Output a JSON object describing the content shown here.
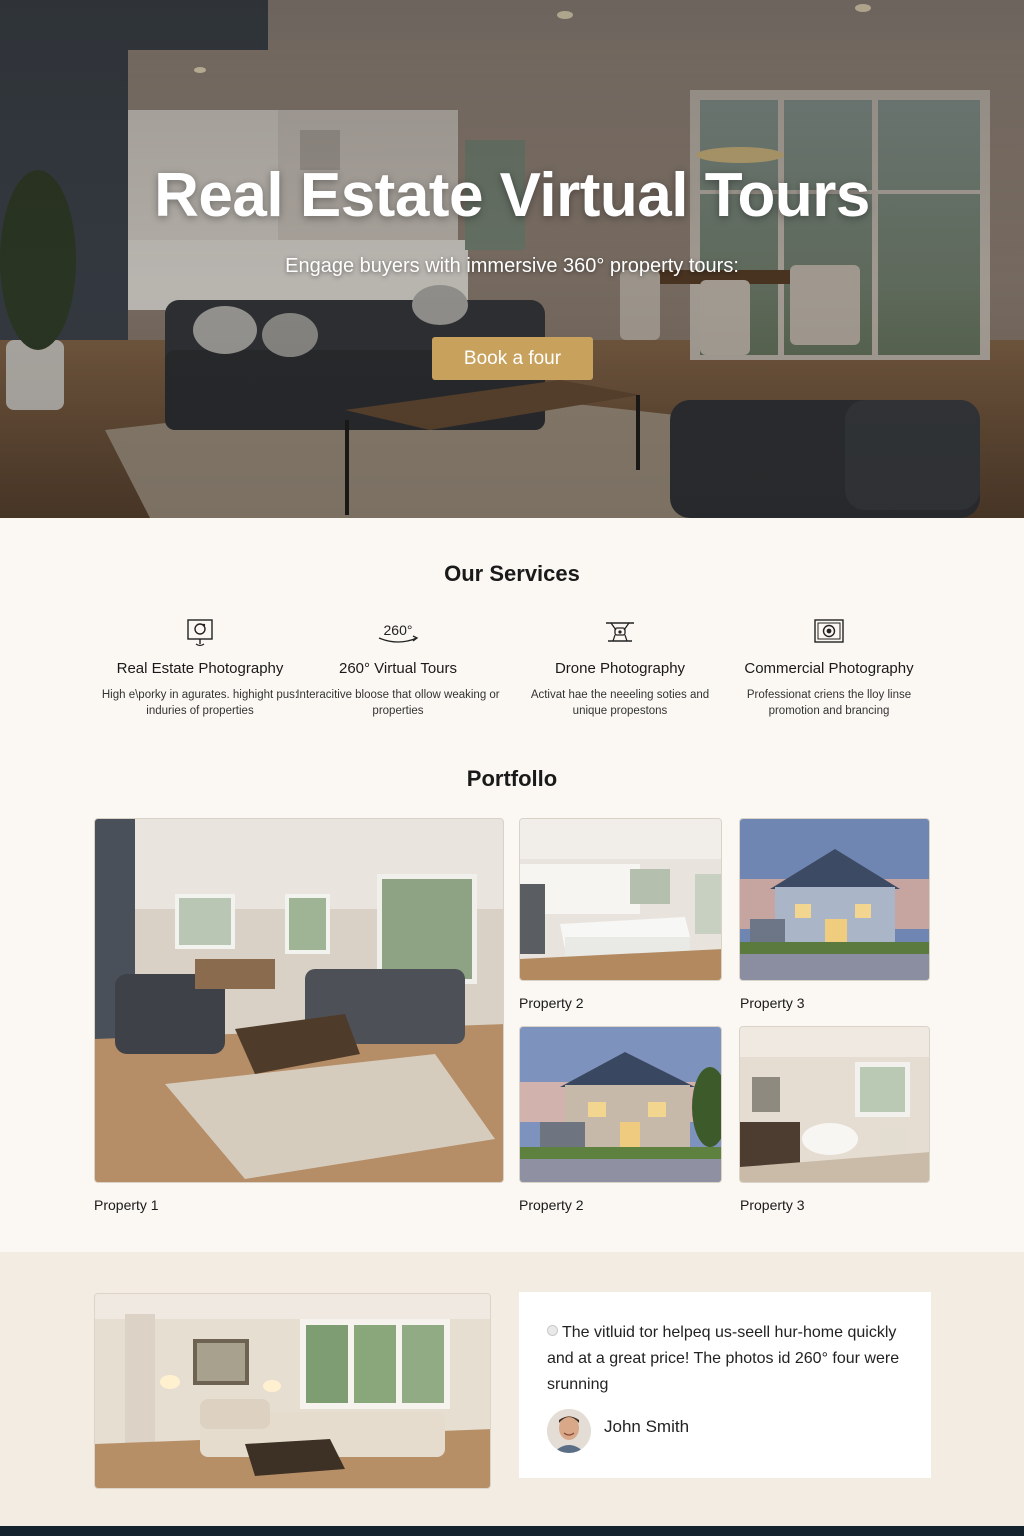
{
  "hero": {
    "title": "Real Estate Virtual Tours",
    "subtitle": "Engage buyers with immersive 360° property tours:",
    "cta_label": "Book a four",
    "accent_color": "#c8a15c"
  },
  "services": {
    "title": "Our Services",
    "items": [
      {
        "icon": "camera-icon",
        "name": "Real Estate Photography",
        "desc": "High e\\porky in agurates. highight pus: induries of properties"
      },
      {
        "icon": "360-icon",
        "icon_text": "260°",
        "name": "260° Virtual Tours",
        "desc": "Interacitive bloose that ollow weaking or properties"
      },
      {
        "icon": "drone-icon",
        "name": "Drone Photography",
        "desc": "Activat hae the neeeling soties and unique propestons"
      },
      {
        "icon": "commercial-camera-icon",
        "name": "Commercial Photography",
        "desc": "Professionat criens the lloy linse promotion and brancing"
      }
    ]
  },
  "portfolio": {
    "title": "Portfollo",
    "items": [
      {
        "caption": "Property 1"
      },
      {
        "caption": "Property 2"
      },
      {
        "caption": "Property 3"
      },
      {
        "caption": "Property 2"
      },
      {
        "caption": "Property 3"
      }
    ]
  },
  "testimonial": {
    "quote": "The vitluid tor helpeq us-seell hur-home quickly and at a great price! The photos id 260° four were srunning",
    "author": "John Smith"
  }
}
